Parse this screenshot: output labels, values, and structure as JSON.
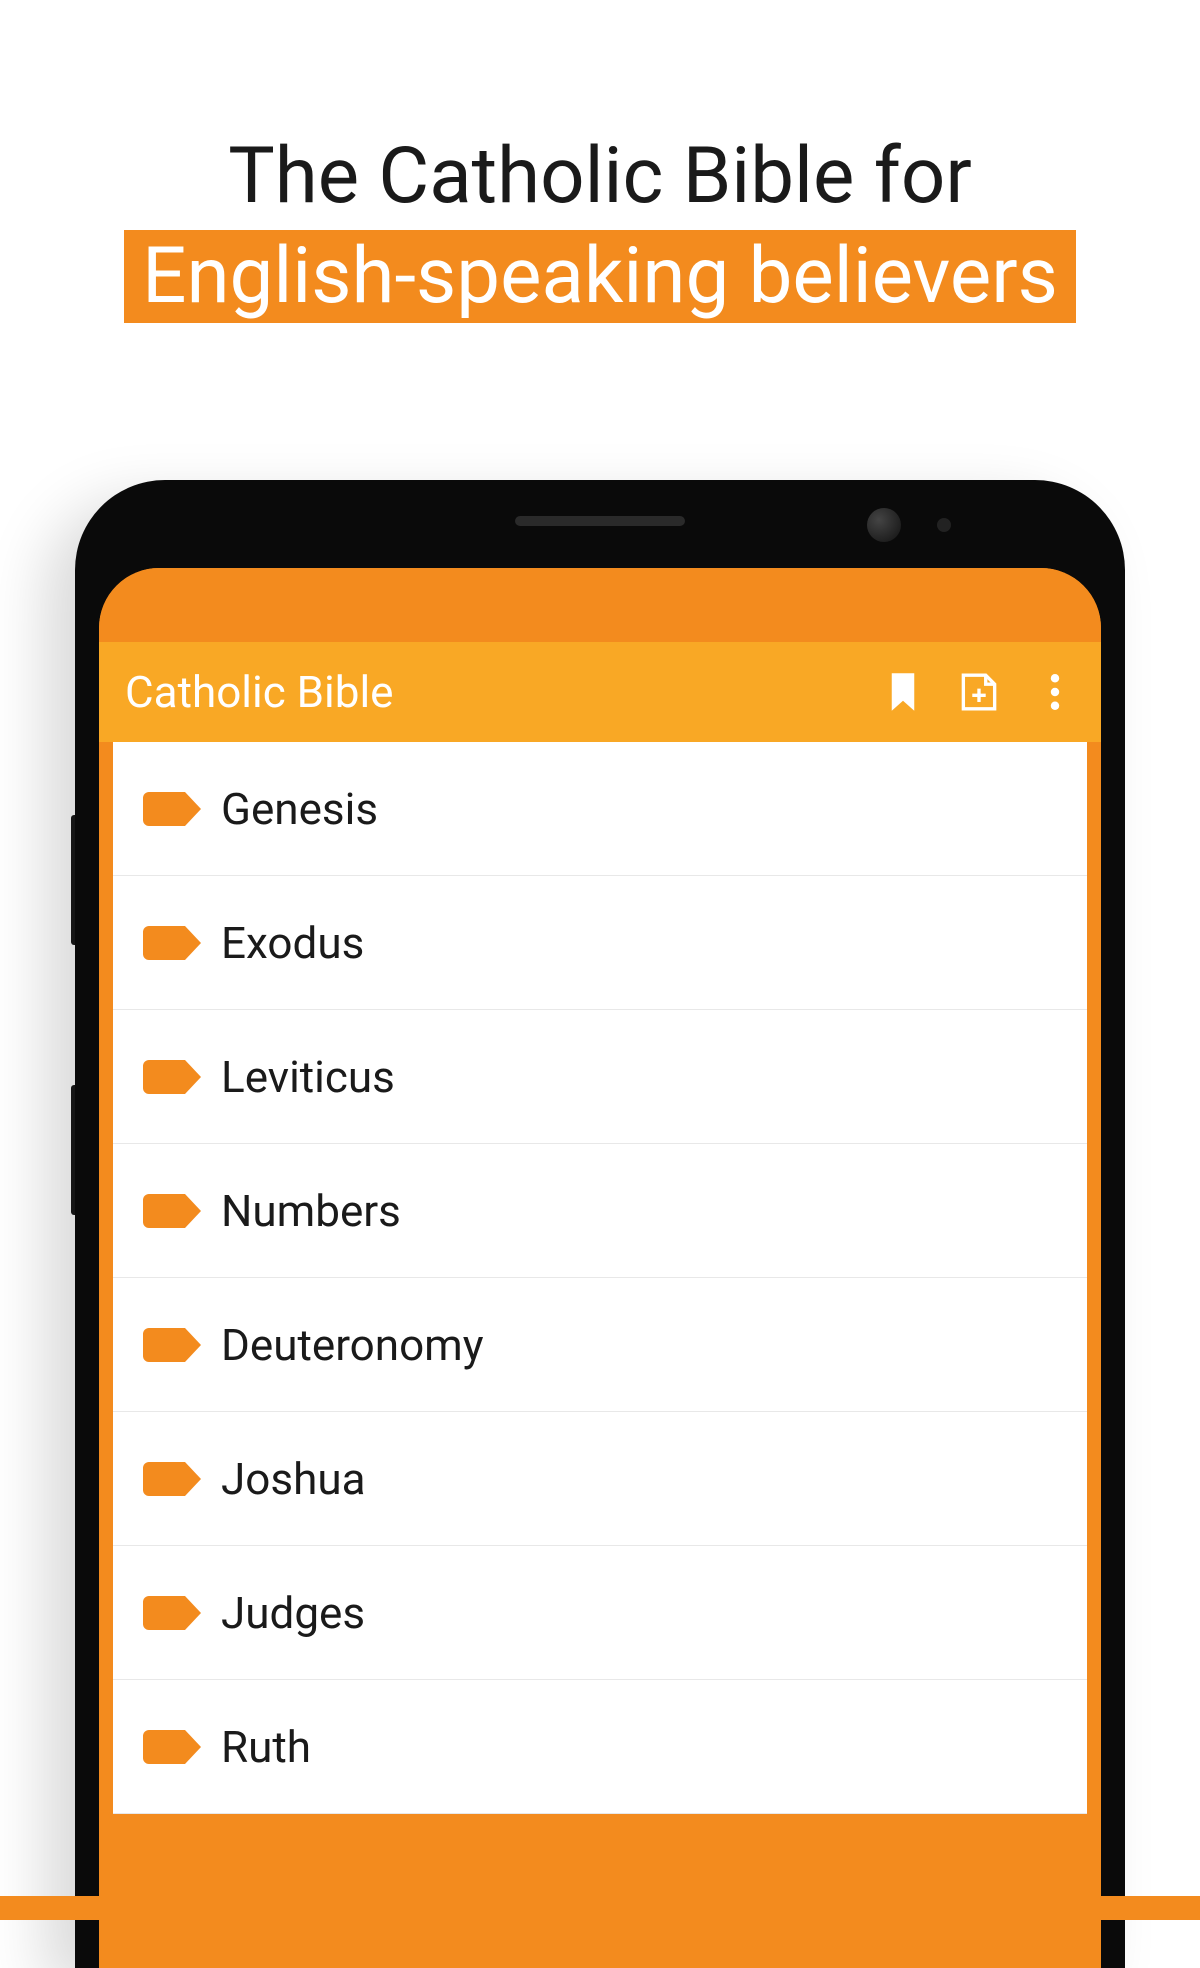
{
  "headline": {
    "line1": "The Catholic Bible for",
    "line2": "English-speaking believers"
  },
  "app": {
    "title": "Catholic Bible"
  },
  "books": [
    {
      "name": "Genesis"
    },
    {
      "name": "Exodus"
    },
    {
      "name": "Leviticus"
    },
    {
      "name": "Numbers"
    },
    {
      "name": "Deuteronomy"
    },
    {
      "name": "Joshua"
    },
    {
      "name": "Judges"
    },
    {
      "name": "Ruth"
    }
  ],
  "colors": {
    "accent_primary": "#f38b1e",
    "accent_secondary": "#f9a825",
    "text_dark": "#1a1a1a"
  }
}
